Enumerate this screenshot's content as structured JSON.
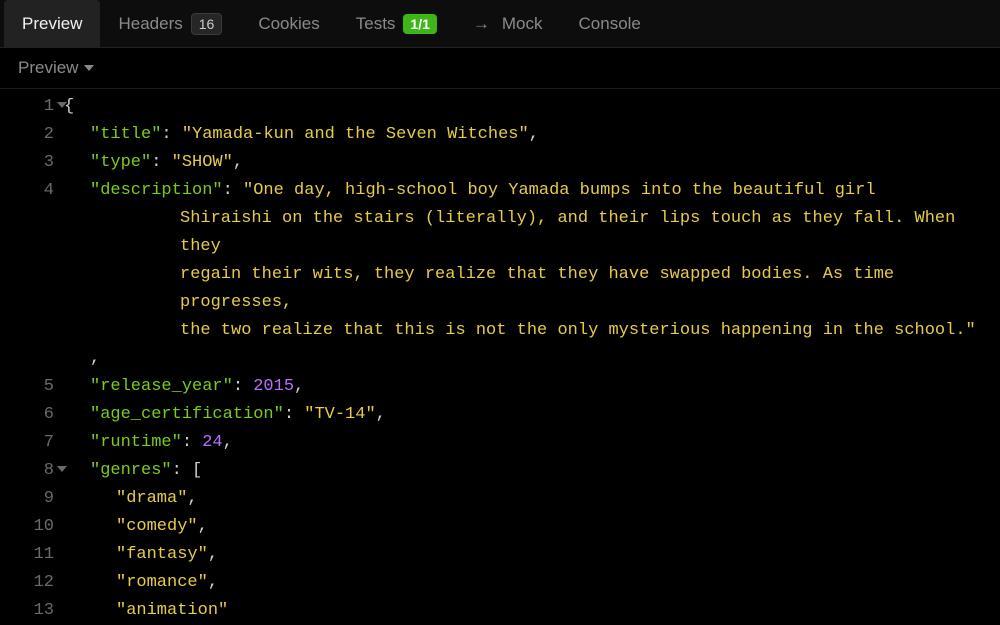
{
  "tabs": {
    "preview": "Preview",
    "headers": "Headers",
    "headers_count": "16",
    "cookies": "Cookies",
    "tests": "Tests",
    "tests_pill": "1/1",
    "mock_arrow": "→",
    "mock": "Mock",
    "console": "Console"
  },
  "subhead": {
    "label": "Preview"
  },
  "lines": {
    "l1": "1",
    "l2": "2",
    "l3": "3",
    "l4": "4",
    "l5": "5",
    "l6": "6",
    "l7": "7",
    "l8": "8",
    "l9": "9",
    "l10": "10",
    "l11": "11",
    "l12": "12",
    "l13": "13"
  },
  "json": {
    "k_title": "\"title\"",
    "v_title": "\"Yamada-kun and the Seven Witches\"",
    "k_type": "\"type\"",
    "v_type": "\"SHOW\"",
    "k_description": "\"description\"",
    "v_desc_a": "\"One day, high-school boy Yamada bumps into the beautiful girl",
    "v_desc_b": "Shiraishi on the stairs (literally), and their lips touch as they fall. When they",
    "v_desc_c": "regain their wits, they realize that they have swapped bodies. As time progresses,",
    "v_desc_d": "the two realize that this is not the only mysterious happening in the school.\"",
    "k_release_year": "\"release_year\"",
    "v_release_year": "2015",
    "k_age_cert": "\"age_certification\"",
    "v_age_cert": "\"TV-14\"",
    "k_runtime": "\"runtime\"",
    "v_runtime": "24",
    "k_genres": "\"genres\"",
    "g1": "\"drama\"",
    "g2": "\"comedy\"",
    "g3": "\"fantasy\"",
    "g4": "\"romance\"",
    "g5": "\"animation\""
  },
  "punct": {
    "open_brace": "{",
    "open_bracket": "[",
    "colon_sp": ": ",
    "comma": ","
  }
}
